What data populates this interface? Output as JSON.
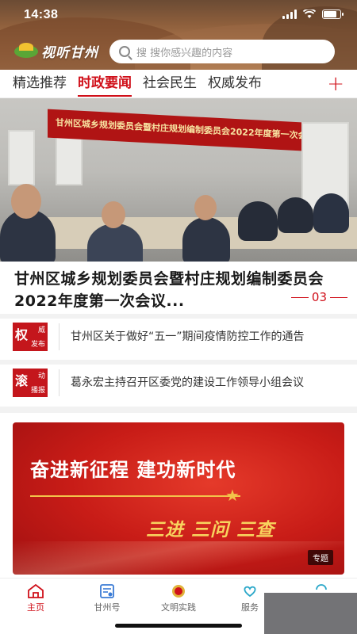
{
  "status": {
    "time": "14:38"
  },
  "header": {
    "logo_text": "视听甘州",
    "search_placeholder": "搜 搜你感兴趣的内容"
  },
  "tabs": [
    {
      "label": "精选推荐",
      "active": false
    },
    {
      "label": "时政要闻",
      "active": true
    },
    {
      "label": "社会民生",
      "active": false
    },
    {
      "label": "权威发布",
      "active": false
    }
  ],
  "tab_plus": "+",
  "hero": {
    "banner_text": "甘州区城乡规划委员会暨村庄规划编制委员会2022年度第一次会议",
    "headline": "甘州区城乡规划委员会暨村庄规划编制委员会2022年度第一次会议...",
    "page_number": "03"
  },
  "news": [
    {
      "badge_main": "权",
      "badge_top": "威",
      "badge_bottom": "发布",
      "title": "甘州区关于做好“五一”期间疫情防控工作的通告"
    },
    {
      "badge_main": "滚",
      "badge_top": "动",
      "badge_bottom": "播报",
      "title": "葛永宏主持召开区委党的建设工作领导小组会议"
    }
  ],
  "promo": {
    "slogan": "奋进新征程  建功新时代",
    "triple": "三进  三问  三查",
    "tag": "专题"
  },
  "bottom_nav": [
    {
      "label": "主页",
      "icon": "home-icon",
      "active": true
    },
    {
      "label": "甘州号",
      "icon": "news-card-icon",
      "active": false
    },
    {
      "label": "文明实践",
      "icon": "emblem-icon",
      "active": false
    },
    {
      "label": "服务",
      "icon": "heart-hands-icon",
      "active": false
    },
    {
      "label": "",
      "icon": "profile-icon",
      "active": false
    }
  ],
  "colors": {
    "accent": "#d0101a",
    "promo": "#c81c17"
  }
}
